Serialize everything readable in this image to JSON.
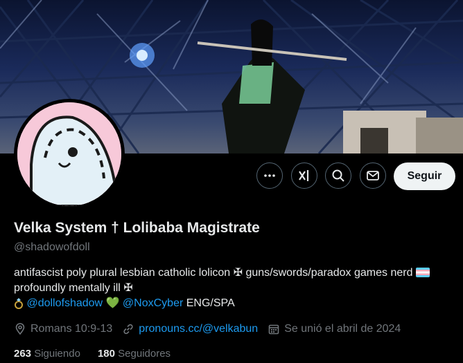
{
  "profile": {
    "display_name": "Velka System † Lolibaba Magistrate",
    "handle": "@shadowofdoll",
    "bio": {
      "line1": "antifascist poly plural lesbian catholic lolicon ✠ guns/swords/paradox games nerd",
      "line2": "profoundly mentally ill ✠",
      "link1": "@dollofshadow",
      "link2": "@NoxCyber",
      "tail": "ENG/SPA",
      "heart": "💚"
    },
    "location": "Romans 10:9-13",
    "website": "pronouns.cc/@velkabun",
    "joined": "Se unió el abril de 2024",
    "following_count": "263",
    "following_label": "Siguiendo",
    "followers_count": "180",
    "followers_label": "Seguidores"
  },
  "actions": {
    "more_icon": "more-dots-icon",
    "grok_icon": "grok-icon",
    "search_icon": "search-icon",
    "message_icon": "message-icon",
    "follow_label": "Seguir"
  },
  "colors": {
    "background": "#000000",
    "text": "#e7e9ea",
    "muted": "#71767b",
    "link": "#1d9bf0",
    "follow_bg": "#eff3f4"
  }
}
